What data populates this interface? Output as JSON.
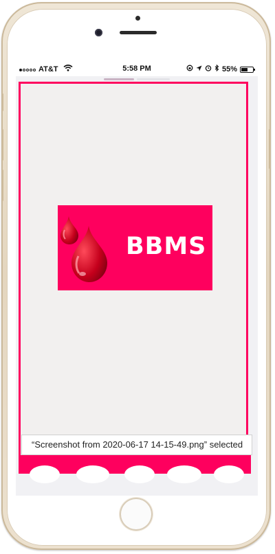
{
  "status_bar": {
    "carrier": "AT&T",
    "time": "5:58 PM",
    "battery_percent": "55%",
    "battery_level": 0.55,
    "signal_bars": 1,
    "icons": [
      "signal-dots-icon",
      "wifi-icon",
      "lock-rotation-icon",
      "location-arrow-icon",
      "alarm-icon",
      "bluetooth-icon",
      "battery-icon"
    ]
  },
  "app": {
    "logo_text": "BBMS",
    "notification": "“Screenshot from 2020-06-17 14-15-49.png” selected"
  },
  "colors": {
    "brand": "#fe005e",
    "background": "#f2f0ef",
    "blood_drop": "#c1001b"
  }
}
